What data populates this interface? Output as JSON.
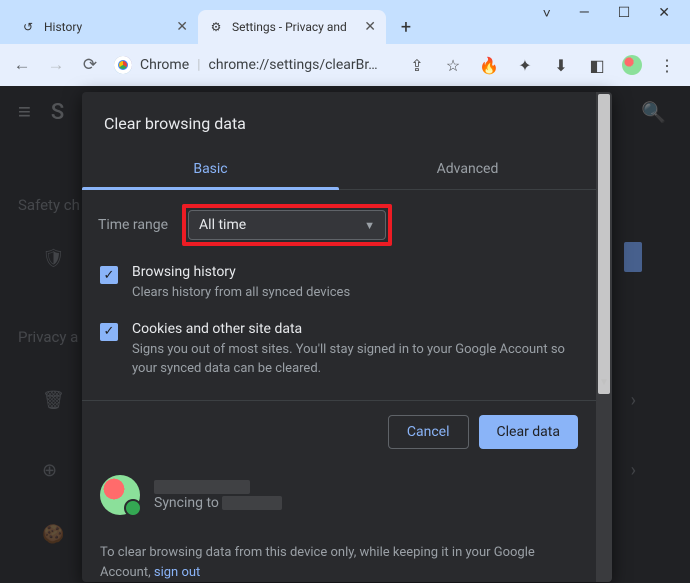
{
  "window": {
    "title_bar": true
  },
  "tabs": {
    "items": [
      {
        "label": "History",
        "active": false
      },
      {
        "label": "Settings - Privacy and",
        "active": true
      }
    ]
  },
  "toolbar": {
    "chrome_label": "Chrome",
    "url": "chrome://settings/clearBr…"
  },
  "bg": {
    "menu_initial": "S",
    "safety_label": "Safety ch",
    "privacy_label": "Privacy a"
  },
  "dialog": {
    "title": "Clear browsing data",
    "tab_basic": "Basic",
    "tab_advanced": "Advanced",
    "time_range_label": "Time range",
    "time_range_value": "All time",
    "items": [
      {
        "title": "Browsing history",
        "desc": "Clears history from all synced devices",
        "checked": true
      },
      {
        "title": "Cookies and other site data",
        "desc": "Signs you out of most sites. You'll stay signed in to your Google Account so your synced data can be cleared.",
        "checked": true
      }
    ],
    "cancel": "Cancel",
    "clear": "Clear data",
    "sync_prefix": "Syncing to",
    "footnote_a": "To clear browsing data from this device only, while keeping it in your Google Account, ",
    "footnote_link": "sign out"
  }
}
